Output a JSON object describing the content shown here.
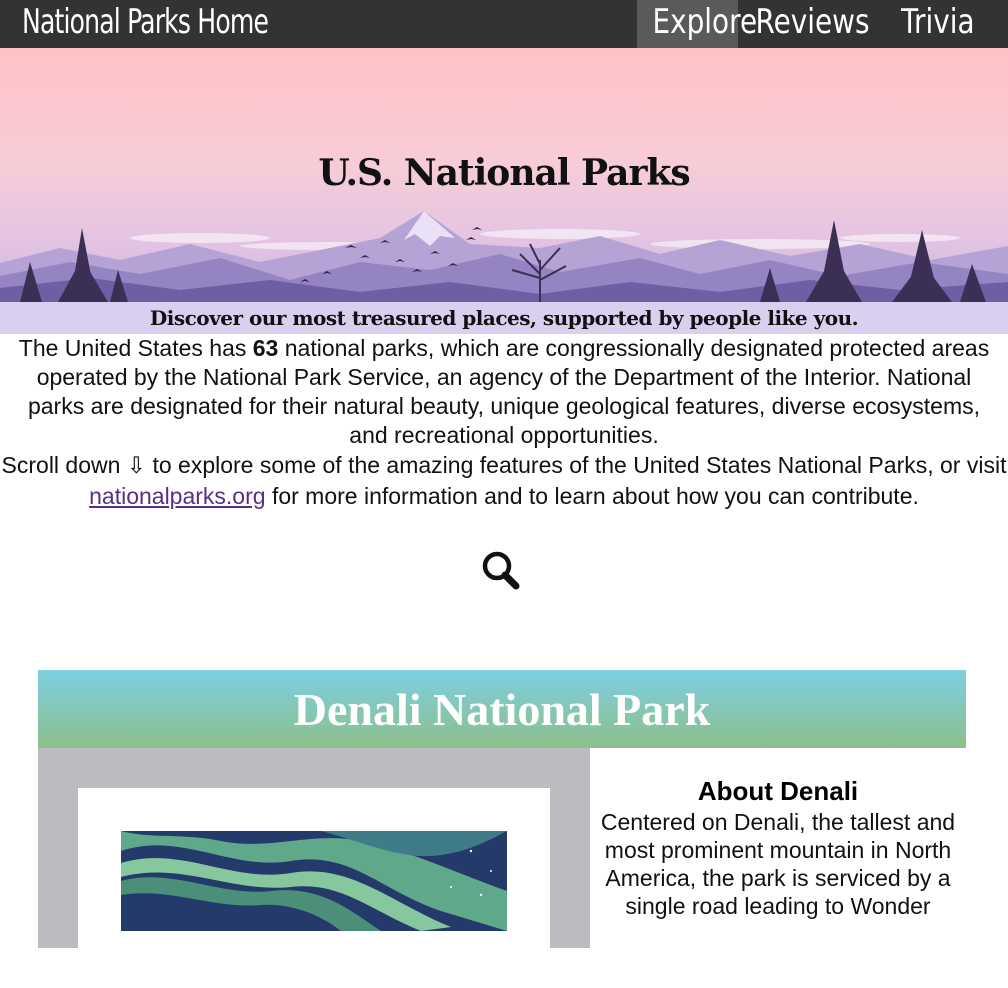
{
  "nav": {
    "home_label": "National Parks Home",
    "links": [
      {
        "label": "Explore",
        "active": true
      },
      {
        "label": "Reviews",
        "active": false
      },
      {
        "label": "Trivia",
        "active": false
      }
    ]
  },
  "hero": {
    "title": "U.S. National Parks",
    "tagline_before": "Discover our most treasured places, supported by people like ",
    "tagline_emphasis": "you."
  },
  "intro": {
    "p1_before": "The United States has ",
    "park_count": "63",
    "p1_after": " national parks, which are congressionally designated protected areas operated by the National Park Service, an agency of the Department of the Interior. National parks are designated for their natural beauty, unique geological features, diverse ecosystems, and recreational opportunities.",
    "p2_before": "Scroll down ⇩ to explore some of the amazing features of the United States National Parks, or visit ",
    "link_text": "nationalparks.org",
    "p2_after": " for more information and to learn about how you can contribute."
  },
  "search": {
    "icon": "search-icon"
  },
  "park": {
    "name": "Denali National Park",
    "about_title": "About Denali",
    "about_text": "Centered on Denali, the tallest and most prominent mountain in North America, the park is serviced by a single road leading to Wonder"
  },
  "colors": {
    "nav_bg": "#333333",
    "nav_active": "#5a5a5a",
    "tagline_bg": "#d9d0f0",
    "link": "#5a2d8a",
    "card_header_top": "#7ecfe3",
    "card_header_bottom": "#8cbf8a",
    "card_media_bg": "#bbbcbf"
  }
}
